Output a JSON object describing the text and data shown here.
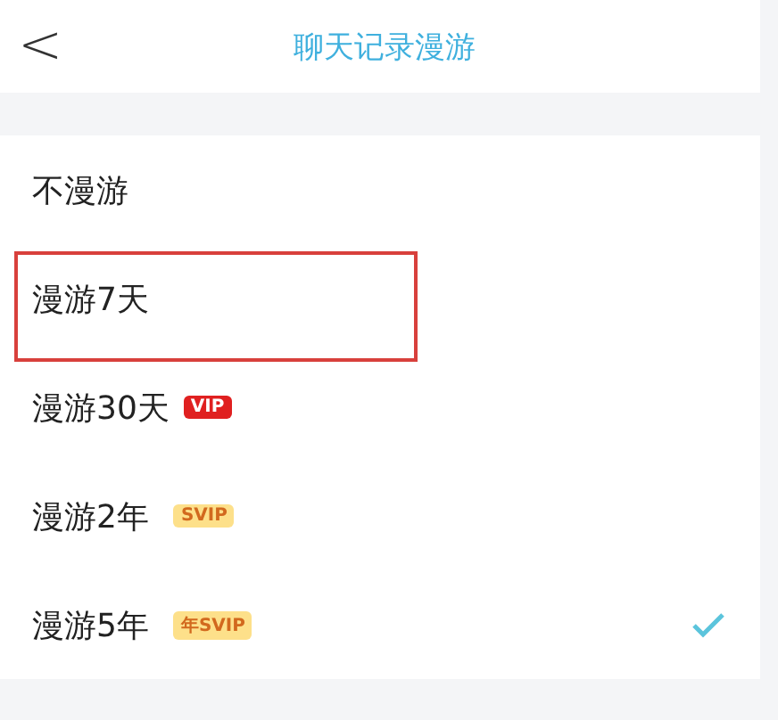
{
  "header": {
    "back": "<",
    "title": "聊天记录漫游"
  },
  "options": [
    {
      "label": "不漫游",
      "selected": false,
      "highlighted": false
    },
    {
      "label": "漫游7天",
      "selected": false,
      "highlighted": true
    },
    {
      "label": "漫游30天",
      "selected": false,
      "highlighted": false,
      "badge": {
        "kind": "vip",
        "text": "VIP"
      }
    },
    {
      "label": "漫游2年",
      "selected": false,
      "highlighted": false,
      "badge": {
        "kind": "svip",
        "text": "SVIP"
      }
    },
    {
      "label": "漫游5年",
      "selected": true,
      "highlighted": false,
      "badge": {
        "kind": "svip",
        "text": "年SVIP"
      }
    }
  ]
}
